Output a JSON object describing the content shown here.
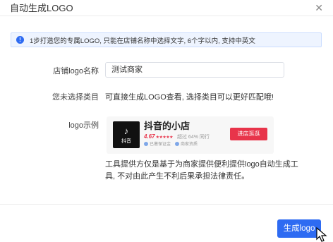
{
  "dialog": {
    "title": "自动生成LOGO",
    "close_glyph": "✕"
  },
  "alert": {
    "icon": "info-icon",
    "icon_glyph": "!",
    "text": "1步打造您的专属LOGO, 只能在店铺名称中选择文字, 6个字以内, 支持中英文"
  },
  "form": {
    "store_name_label": "店铺logo名称",
    "store_name_value": "测试商家",
    "category_label": "您未选择类目",
    "category_text": "可直接生成LOGO查看, 选择类目可以更好匹配哦!",
    "example_label": "logo示例"
  },
  "preview": {
    "logo_icon": "tiktok-note-icon",
    "logo_glyph": "♪",
    "logo_text": "抖音",
    "shop_name": "抖音的小店",
    "rating": "4.67",
    "stars": "★★★★★",
    "stat": "超过 64% 同行",
    "badge1": "已缴保证金",
    "badge2": "商家资质",
    "visit_button": "进店逛逛"
  },
  "disclaimer": "工具提供方仅是基于为商家提供便利提供logo自动生成工具, 不对由此产生不利后果承担法律责任。",
  "footer": {
    "generate_button": "生成logo"
  },
  "colors": {
    "primary": "#2e6bf2",
    "accent_red": "#e8344a",
    "alert_bg": "#eef4ff"
  }
}
